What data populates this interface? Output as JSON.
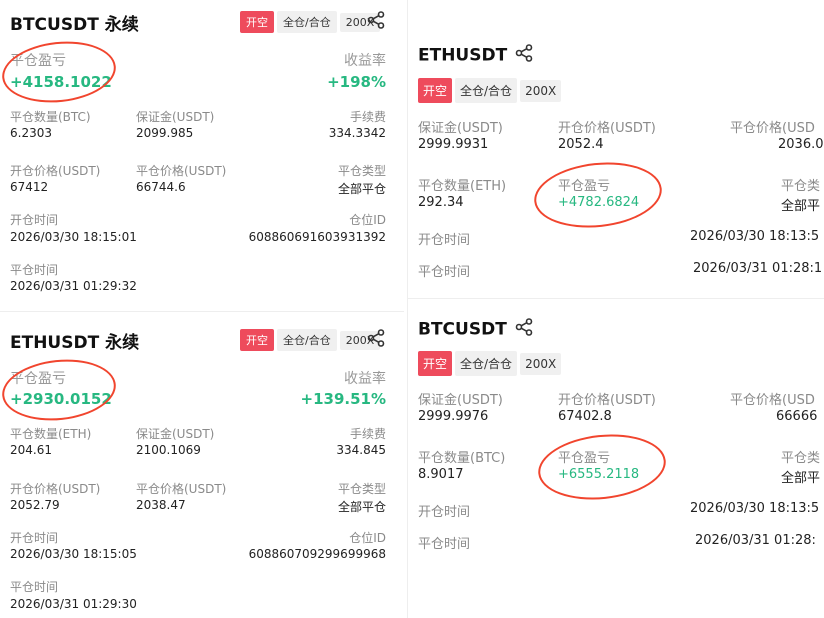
{
  "cards": {
    "btc_left": {
      "symbol": "BTCUSDT",
      "suffix": "永续",
      "tags": [
        "开空",
        "全仓/合仓",
        "200X"
      ],
      "pnl_label": "平仓盈亏",
      "pnl_value": "+4158.1022",
      "roi_label": "收益率",
      "roi_value": "+198%",
      "qty_label": "平仓数量(BTC)",
      "qty_value": "6.2303",
      "margin_label": "保证金(USDT)",
      "margin_value": "2099.985",
      "fee_label": "手续费",
      "fee_value": "334.3342",
      "open_price_label": "开仓价格(USDT)",
      "open_price_value": "67412",
      "close_price_label": "平仓价格(USDT)",
      "close_price_value": "66744.6",
      "close_type_label": "平仓类型",
      "close_type_value": "全部平仓",
      "open_time_label": "开仓时间",
      "open_time_value": "2026/03/30 18:15:01",
      "position_id_label": "仓位ID",
      "position_id_value": "608860691603931392",
      "close_time_label": "平仓时间",
      "close_time_value": "2026/03/31 01:29:32"
    },
    "eth_left": {
      "symbol": "ETHUSDT",
      "suffix": "永续",
      "tags": [
        "开空",
        "全仓/合仓",
        "200X"
      ],
      "pnl_label": "平仓盈亏",
      "pnl_value": "+2930.0152",
      "roi_label": "收益率",
      "roi_value": "+139.51%",
      "qty_label": "平仓数量(ETH)",
      "qty_value": "204.61",
      "margin_label": "保证金(USDT)",
      "margin_value": "2100.1069",
      "fee_label": "手续费",
      "fee_value": "334.845",
      "open_price_label": "开仓价格(USDT)",
      "open_price_value": "2052.79",
      "close_price_label": "平仓价格(USDT)",
      "close_price_value": "2038.47",
      "close_type_label": "平仓类型",
      "close_type_value": "全部平仓",
      "open_time_label": "开仓时间",
      "open_time_value": "2026/03/30 18:15:05",
      "position_id_label": "仓位ID",
      "position_id_value": "608860709299699968",
      "close_time_label": "平仓时间",
      "close_time_value": "2026/03/31 01:29:30"
    },
    "eth_right": {
      "symbol": "ETHUSDT",
      "tags": [
        "开空",
        "全仓/合仓",
        "200X"
      ],
      "margin_label": "保证金(USDT)",
      "margin_value": "2999.9931",
      "open_price_label": "开仓价格(USDT)",
      "open_price_value": "2052.4",
      "close_price_label": "平仓价格(USD",
      "close_price_value": "2036.0",
      "qty_label": "平仓数量(ETH)",
      "qty_value": "292.34",
      "pnl_label": "平仓盈亏",
      "pnl_value": "+4782.6824",
      "close_type_label": "平仓类",
      "close_type_value": "全部平",
      "open_time_label": "开仓时间",
      "open_time_value": "2026/03/30 18:13:5",
      "close_time_label": "平仓时间",
      "close_time_value": "2026/03/31 01:28:1"
    },
    "btc_right": {
      "symbol": "BTCUSDT",
      "tags": [
        "开空",
        "全仓/合仓",
        "200X"
      ],
      "margin_label": "保证金(USDT)",
      "margin_value": "2999.9976",
      "open_price_label": "开仓价格(USDT)",
      "open_price_value": "67402.8",
      "close_price_label": "平仓价格(USD",
      "close_price_value": "66666",
      "qty_label": "平仓数量(BTC)",
      "qty_value": "8.9017",
      "pnl_label": "平仓盈亏",
      "pnl_value": "+6555.2118",
      "close_type_label": "平仓类",
      "close_type_value": "全部平",
      "open_time_label": "开仓时间",
      "open_time_value": "2026/03/30 18:13:5",
      "close_time_label": "平仓时间",
      "close_time_value": "2026/03/31 01:28:"
    }
  },
  "colors": {
    "profit_green": "#27b881",
    "short_tag_red": "#ee4b5c",
    "annotation_red": "#f1452e"
  }
}
